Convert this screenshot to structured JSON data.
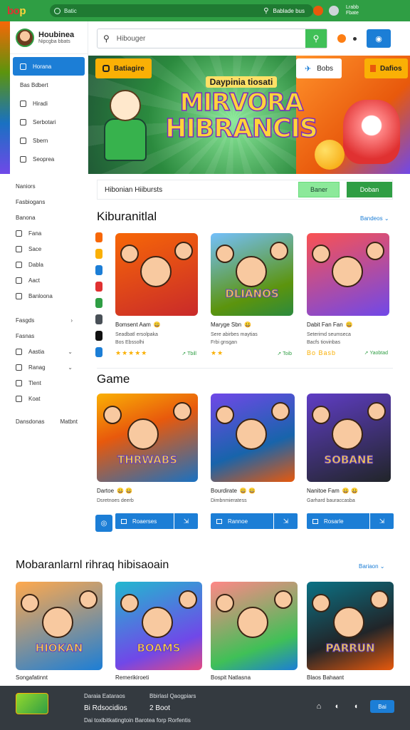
{
  "topbar": {
    "logo_a": "bo",
    "logo_b": "p",
    "search_text": "Batic",
    "right_text": "Bablade bus",
    "menu_a": "Lrabb",
    "menu_b": "Fbate"
  },
  "profile": {
    "name": "Houbinea",
    "subtitle": "Nipcgba bbats"
  },
  "sidebar": {
    "items": [
      {
        "label": "Horana",
        "active": true
      },
      {
        "label": "Bas Bdbert",
        "active": false
      },
      {
        "label": "Hiradi",
        "active": false
      },
      {
        "label": "Serbotari",
        "active": false
      },
      {
        "label": "Sbern",
        "active": false
      },
      {
        "label": "Seoprea",
        "active": false
      }
    ],
    "lower": [
      {
        "label": "Naniors",
        "icon": false
      },
      {
        "label": "Fasbiogans",
        "icon": false
      },
      {
        "label": "Banona",
        "icon": false
      },
      {
        "label": "Fana",
        "icon": true
      },
      {
        "label": "Sace",
        "icon": true
      },
      {
        "label": "Dabla",
        "icon": true
      },
      {
        "label": "Aact",
        "icon": true
      },
      {
        "label": "Banloona",
        "icon": true
      }
    ],
    "lower2": [
      {
        "label": "Fasgds",
        "icon": false,
        "chev": ">"
      },
      {
        "label": "Fasnas",
        "icon": false,
        "chev": ""
      },
      {
        "label": "Aastia",
        "icon": true,
        "chev": "v"
      },
      {
        "label": "Ranag",
        "icon": true,
        "chev": "v"
      },
      {
        "label": "Tlent",
        "icon": true,
        "chev": ""
      },
      {
        "label": "Koat",
        "icon": true,
        "chev": ""
      }
    ],
    "foot_a": "Dansdonas",
    "foot_b": "Matbnt"
  },
  "search": {
    "placeholder": "Hibouger"
  },
  "hero": {
    "badge": "Batiagire",
    "kicker": "Daypinia tiosati",
    "title_1": "MIRVORA",
    "title_2": "HIBRANCIS",
    "button_1": "Bobs",
    "button_2": "Dafios"
  },
  "filter": {
    "label": "Hibonian Hiibursts",
    "btn_1": "Baner",
    "btn_2": "Doban"
  },
  "section_1": {
    "title": "Kiburanitlal",
    "more": "Bandeos"
  },
  "section_2": {
    "title": "Game"
  },
  "section_3": {
    "title": "Mobaranlarnl rihraq hibisaoain",
    "more": "Bariaon"
  },
  "cards_1": [
    {
      "title": "Bomsent Aam",
      "meta": "Seadbatl ersolpaka",
      "stats": "Bos Ebssolhi",
      "rating": "★★★★★",
      "num": "Tbill",
      "word": ""
    },
    {
      "title": "Maryge Sbn",
      "meta": "Sere abirbes maytias",
      "stats": "Frbi gnsgan",
      "rating": "★★",
      "num": "Toib",
      "word": "DLIANOS"
    },
    {
      "title": "Dabit Fan Fan",
      "meta": "Seterimd seumseca",
      "stats": "Bacfs tiovinbas",
      "rating": "Bo Basb",
      "num": "Yaobtad",
      "word": ""
    }
  ],
  "cards_2": [
    {
      "title": "Dartoe",
      "meta": "Dsretnoes deerb",
      "word": "THRWABS",
      "action": "Roaerses"
    },
    {
      "title": "Bourdirate",
      "meta": "Dimbnmieratess",
      "word": "",
      "action": "Rannoe"
    },
    {
      "title": "Nanitoe Fam",
      "meta": "Garhard bauraccasba",
      "word": "SOBANE",
      "action": "Rosarle"
    }
  ],
  "cards_3": [
    {
      "caption": "Songafatinnt",
      "word": "HIOKAN"
    },
    {
      "caption": "Remerikiroeti",
      "word": "BOAMS"
    },
    {
      "caption": "Bospit Natlasna",
      "word": ""
    },
    {
      "caption": "Blaos Bahaant",
      "word": "PARRUN"
    }
  ],
  "footer": {
    "c1a": "Daraia Eataraos",
    "c1b": "Bi Rdsocidios",
    "c2a": "Bbirlasl Qaogpiars",
    "c2b": "2 Boot",
    "bottom": "Dai toxlbitkatingtoin Barotea forp Rorfentis",
    "btn": "Bai"
  },
  "colors": {
    "brand_green": "#2f9e44",
    "accent_blue": "#1c7ed6",
    "warn_yellow": "#fab005"
  }
}
